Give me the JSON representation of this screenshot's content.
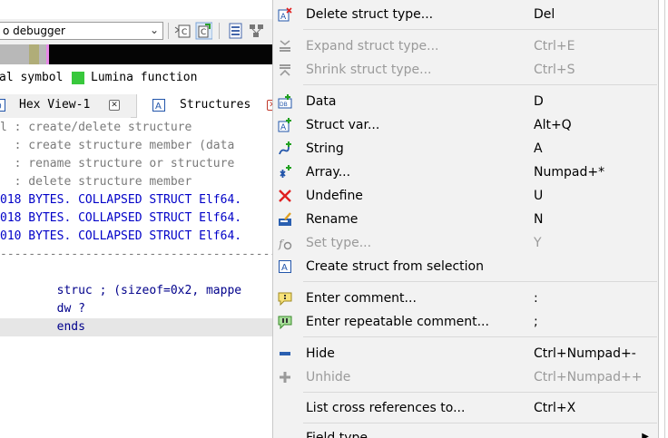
{
  "toolbar": {
    "debugger_value": "o debugger"
  },
  "legend": {
    "left_text": "al symbol",
    "lumina_text": "Lumina function",
    "lumina_color": "#38c83c"
  },
  "tabs": [
    {
      "label": "Hex View-1",
      "icon": "hex-view-icon"
    },
    {
      "label": "Structures",
      "icon": "structures-icon"
    }
  ],
  "code": {
    "comment_lines": [
      "l : create/delete structure",
      "  : create structure member (data",
      "  : rename structure or structure",
      "  : delete structure member"
    ],
    "struct_lines": [
      "018 BYTES. COLLAPSED STRUCT Elf64.",
      "018 BYTES. COLLAPSED STRUCT Elf64.",
      "010 BYTES. COLLAPSED STRUCT Elf64."
    ],
    "separator": "------------------------------------------",
    "body_lines": [
      "        struc ; (sizeof=0x2, mappe",
      "        dw ?",
      "        ends"
    ]
  },
  "menu": {
    "items": [
      {
        "label": "Delete struct type...",
        "shortcut": "Del",
        "icon": "delete-struct-icon",
        "disabled": false
      },
      {
        "label": "Expand struct type...",
        "shortcut": "Ctrl+E",
        "icon": "expand-struct-icon",
        "disabled": true
      },
      {
        "label": "Shrink struct type...",
        "shortcut": "Ctrl+S",
        "icon": "shrink-struct-icon",
        "disabled": true
      },
      {
        "label": "Data",
        "shortcut": "D",
        "icon": "data-icon",
        "disabled": false
      },
      {
        "label": "Struct var...",
        "shortcut": "Alt+Q",
        "icon": "struct-var-icon",
        "disabled": false
      },
      {
        "label": "String",
        "shortcut": "A",
        "icon": "string-icon",
        "disabled": false
      },
      {
        "label": "Array...",
        "shortcut": "Numpad+*",
        "icon": "array-icon",
        "disabled": false
      },
      {
        "label": "Undefine",
        "shortcut": "U",
        "icon": "undefine-icon",
        "disabled": false
      },
      {
        "label": "Rename",
        "shortcut": "N",
        "icon": "rename-icon",
        "disabled": false
      },
      {
        "label": "Set type...",
        "shortcut": "Y",
        "icon": "set-type-icon",
        "disabled": true
      },
      {
        "label": "Create struct from selection",
        "shortcut": "",
        "icon": "create-struct-icon",
        "disabled": false
      },
      {
        "label": "Enter comment...",
        "shortcut": ":",
        "icon": "comment-icon",
        "disabled": false
      },
      {
        "label": "Enter repeatable comment...",
        "shortcut": ";",
        "icon": "repeatable-comment-icon",
        "disabled": false
      },
      {
        "label": "Hide",
        "shortcut": "Ctrl+Numpad+-",
        "icon": "hide-icon",
        "disabled": false
      },
      {
        "label": "Unhide",
        "shortcut": "Ctrl+Numpad++",
        "icon": "unhide-icon",
        "disabled": true
      },
      {
        "label": "List cross references to...",
        "shortcut": "Ctrl+X",
        "icon": "",
        "disabled": false
      },
      {
        "label": "Field type",
        "shortcut": "",
        "icon": "",
        "disabled": false,
        "submenu": true
      }
    ]
  }
}
